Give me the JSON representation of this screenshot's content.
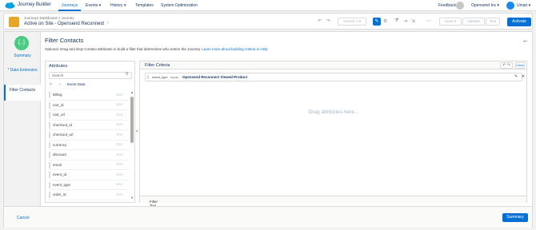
{
  "app": {
    "name": "Journey Builder"
  },
  "nav": {
    "items": [
      {
        "label": "Journeys",
        "active": true
      },
      {
        "label": "Events ▾",
        "active": false
      },
      {
        "label": "History ▾",
        "active": false
      },
      {
        "label": "Templates",
        "active": false
      },
      {
        "label": "System Optimization",
        "active": false
      }
    ],
    "feedback": "Feedback",
    "org": "Opensend Inc ▾",
    "user": "Umair ▾"
  },
  "journey": {
    "breadcrumb": "Journeys Dashboard > Journey",
    "title": "Active on Site - Opensend Reconnect",
    "version": "Version 1",
    "save": "Save",
    "validate": "Validate",
    "test": "Test",
    "activate": "Activate"
  },
  "steps": [
    {
      "label": "Summary"
    },
    {
      "label": "* Data Extension"
    },
    {
      "label": "Filter Contacts"
    }
  ],
  "panel": {
    "title": "Filter Contacts",
    "description": "Optional. Drag and drop Contact attributes to build a filter that determines who enters the Journey.",
    "link": "Learn more about building criteria in Help"
  },
  "attributes": {
    "title": "Attributes",
    "search_placeholder": "Search",
    "folder": "Event Data",
    "items": [
      {
        "name": "billing",
        "type": "TEXT"
      },
      {
        "name": "cart_id",
        "type": "TEXT"
      },
      {
        "name": "cart_url",
        "type": "TEXT"
      },
      {
        "name": "checkout_id",
        "type": "TEXT"
      },
      {
        "name": "checkout_url",
        "type": "TEXT"
      },
      {
        "name": "currency",
        "type": "TEXT"
      },
      {
        "name": "discount",
        "type": "TEXT"
      },
      {
        "name": "email",
        "type": "TEXT"
      },
      {
        "name": "event_id",
        "type": "TEXT"
      },
      {
        "name": "event_type",
        "type": "TEXT"
      },
      {
        "name": "order_id",
        "type": "TEXT"
      }
    ]
  },
  "criteria": {
    "title": "Filter Criteria",
    "clear": "Clear",
    "condition": {
      "field": "event_type",
      "operator": "equal",
      "value": "Opensend Reconnect Viewed Product"
    },
    "dropzone": "Drag attributes here...",
    "filter_text": "Filter Text"
  },
  "footer": {
    "cancel": "Cancel",
    "summary": "Summary"
  },
  "colors": {
    "accent": "#0070d2",
    "journey_icon": "#e8a628",
    "step_done": "#4bca81"
  }
}
